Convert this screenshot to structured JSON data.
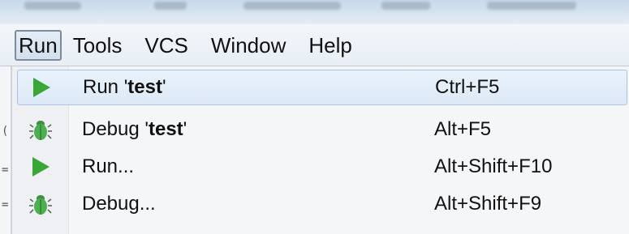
{
  "menubar": {
    "items": [
      {
        "label": "Run",
        "active": true
      },
      {
        "label": "Tools",
        "active": false
      },
      {
        "label": "VCS",
        "active": false
      },
      {
        "label": "Window",
        "active": false
      },
      {
        "label": "Help",
        "active": false
      }
    ]
  },
  "editor_edge": {
    "glyphs": [
      "(",
      "=",
      "="
    ]
  },
  "run_menu": {
    "items": [
      {
        "icon": "run-icon",
        "prefix": "Run '",
        "bold": "test",
        "suffix": "'",
        "shortcut": "Ctrl+F5",
        "highlighted": true
      },
      {
        "icon": "debug-icon",
        "prefix": "Debug '",
        "bold": "test",
        "suffix": "'",
        "shortcut": "Alt+F5",
        "highlighted": false
      },
      {
        "icon": "run-icon",
        "prefix": "Run...",
        "bold": "",
        "suffix": "",
        "shortcut": "Alt+Shift+F10",
        "highlighted": false
      },
      {
        "icon": "debug-icon",
        "prefix": "Debug...",
        "bold": "",
        "suffix": "",
        "shortcut": "Alt+Shift+F9",
        "highlighted": false
      }
    ]
  },
  "colors": {
    "run_icon": "#3aa635",
    "debug_icon": "#4caf50",
    "highlight_border": "#a9c3e0"
  }
}
